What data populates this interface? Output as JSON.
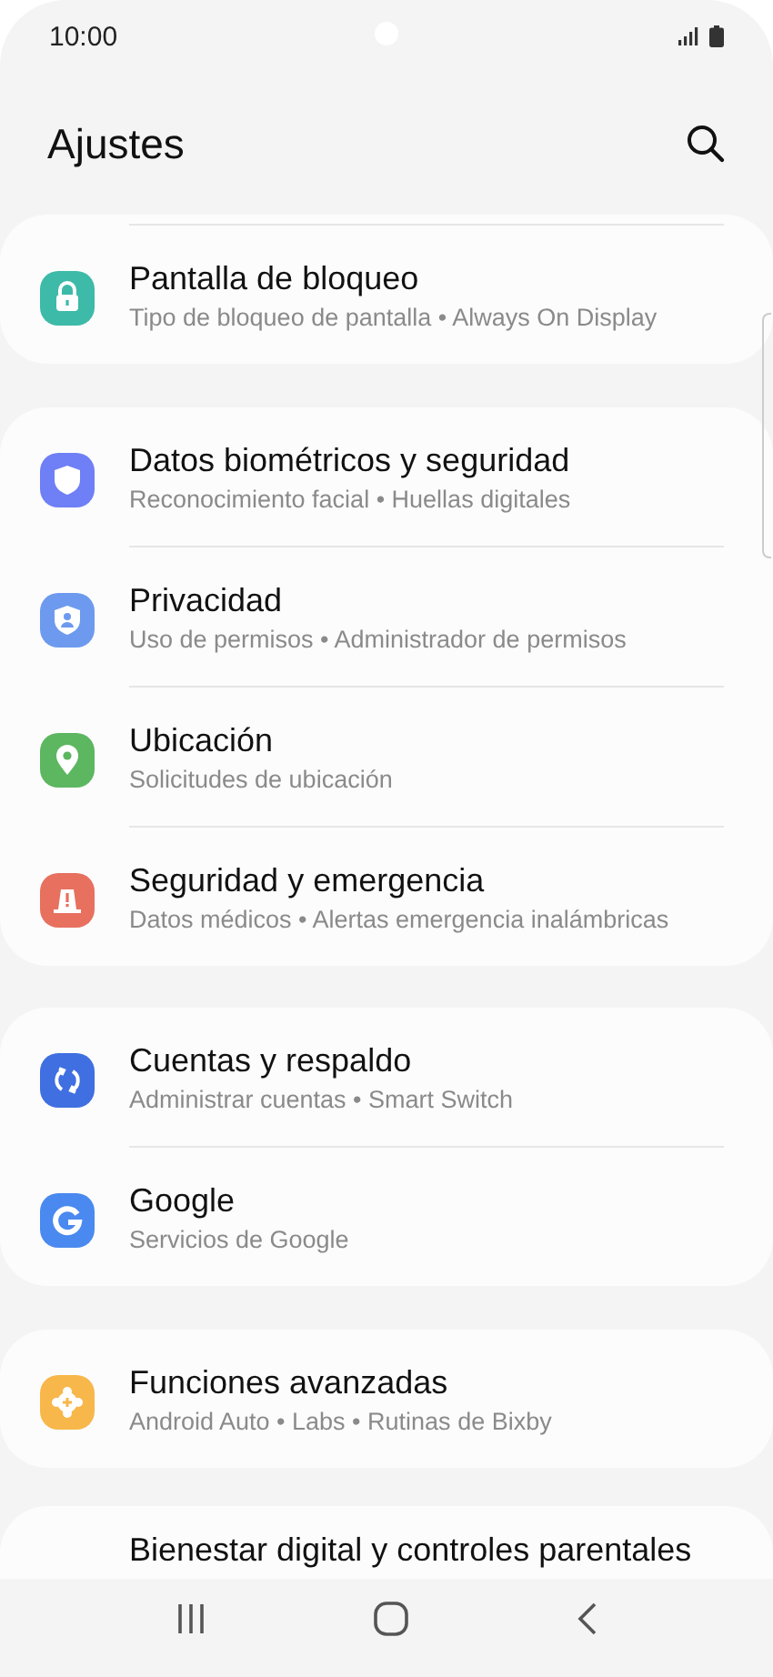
{
  "status_bar": {
    "time": "10:00"
  },
  "header": {
    "title": "Ajustes"
  },
  "cards": [
    {
      "items": [
        {
          "title": "Pantalla de bloqueo",
          "subtitle": "Tipo de bloqueo de pantalla  •  Always On Display",
          "color": "#3dbaa8"
        }
      ]
    },
    {
      "items": [
        {
          "title": "Datos biométricos y seguridad",
          "subtitle": "Reconocimiento facial  •  Huellas digitales",
          "color": "#6f7ff5"
        },
        {
          "title": "Privacidad",
          "subtitle": "Uso de permisos  •  Administrador de permisos",
          "color": "#6d9aee"
        },
        {
          "title": "Ubicación",
          "subtitle": "Solicitudes de ubicación",
          "color": "#5db660"
        },
        {
          "title": "Seguridad y emergencia",
          "subtitle": "Datos médicos  •  Alertas emergencia inalámbricas",
          "color": "#e8705f"
        }
      ]
    },
    {
      "items": [
        {
          "title": "Cuentas y respaldo",
          "subtitle": "Administrar cuentas  •  Smart Switch",
          "color": "#3f6fe0"
        },
        {
          "title": "Google",
          "subtitle": "Servicios de Google",
          "color": "#4a89ef"
        }
      ]
    },
    {
      "items": [
        {
          "title": "Funciones avanzadas",
          "subtitle": "Android Auto  •  Labs  •  Rutinas de Bixby",
          "color": "#f8b74a"
        }
      ]
    }
  ],
  "partial_item": {
    "title": "Bienestar digital y controles parentales"
  }
}
